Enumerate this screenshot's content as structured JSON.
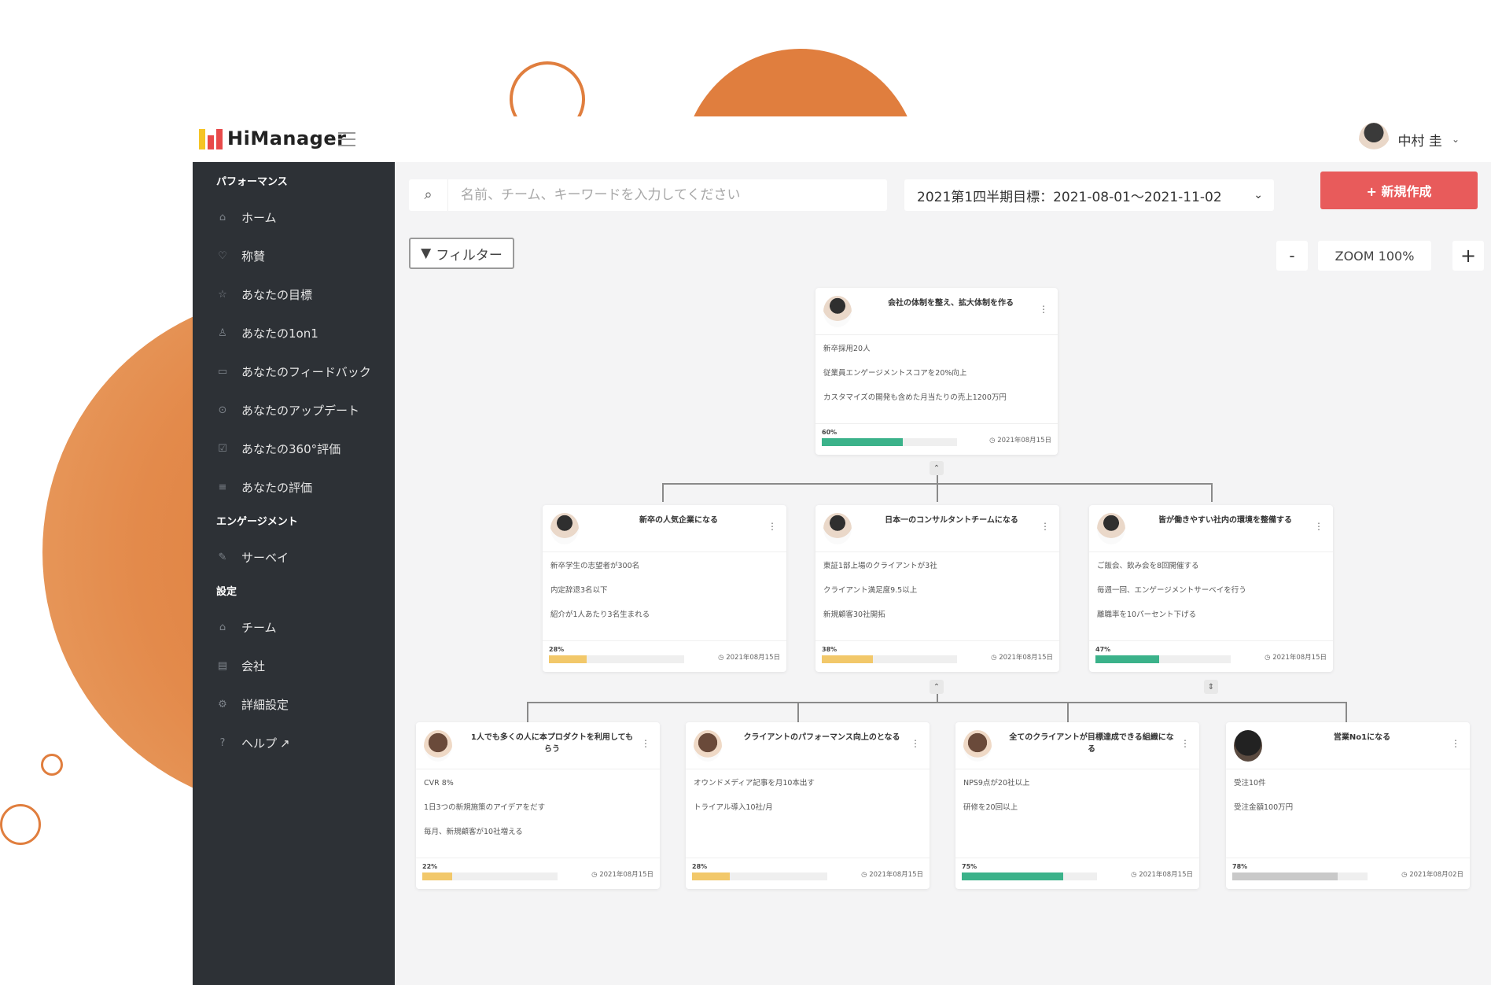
{
  "app": {
    "name": "HiManager"
  },
  "user": {
    "name": "中村 圭"
  },
  "sidebar": {
    "sections": [
      {
        "title": "パフォーマンス",
        "items": [
          {
            "label": "ホーム",
            "icon": "home-icon"
          },
          {
            "label": "称賛",
            "icon": "badge-icon"
          },
          {
            "label": "あなたの目標",
            "icon": "star-icon"
          },
          {
            "label": "あなたの1on1",
            "icon": "users-icon"
          },
          {
            "label": "あなたのフィードバック",
            "icon": "comment-icon"
          },
          {
            "label": "あなたのアップデート",
            "icon": "check-circle-icon"
          },
          {
            "label": "あなたの360°評価",
            "icon": "check-square-icon"
          },
          {
            "label": "あなたの評価",
            "icon": "list-icon"
          }
        ]
      },
      {
        "title": "エンゲージメント",
        "items": [
          {
            "label": "サーベイ",
            "icon": "edit-icon"
          }
        ]
      },
      {
        "title": "設定",
        "items": [
          {
            "label": "チーム",
            "icon": "team-icon"
          },
          {
            "label": "会社",
            "icon": "building-icon"
          },
          {
            "label": "詳細設定",
            "icon": "gears-icon"
          },
          {
            "label": "ヘルプ",
            "icon": "help-icon"
          }
        ]
      }
    ]
  },
  "search": {
    "placeholder": "名前、チーム、キーワードを入力してください"
  },
  "period": {
    "selected": "2021第1四半期目標：2021-08-01〜2021-11-02"
  },
  "actions": {
    "new_label": "+ 新規作成",
    "filter_label": "フィルター"
  },
  "zoom": {
    "minus": "-",
    "label": "ZOOM 100%",
    "plus": "+"
  },
  "colors": {
    "accent_red": "#e85b5b",
    "green": "#3bb28a",
    "yellow": "#f2c86a",
    "gray": "#c9c9c9",
    "sidebar": "#2d3136",
    "orange": "#e07e3e"
  },
  "goals": {
    "root": {
      "title": "会社の体制を整え、拡大体制を作る",
      "krs": [
        "新卒採用20人",
        "従業員エンゲージメントスコアを20%向上",
        "カスタマイズの開発も含めた月当たりの売上1200万円"
      ],
      "progress_label": "60%",
      "progress": 0.6,
      "bar_color": "#3bb28a",
      "due": "2021年08月15日"
    },
    "level2": [
      {
        "title": "新卒の人気企業になる",
        "krs": [
          "新卒学生の志望者が300名",
          "内定辞退3名以下",
          "紹介が1人あたり3名生まれる"
        ],
        "progress_label": "28%",
        "progress": 0.28,
        "bar_color": "#f2c86a",
        "due": "2021年08月15日",
        "avatar": "m"
      },
      {
        "title": "日本一のコンサルタントチームになる",
        "krs": [
          "東証1部上場のクライアントが3社",
          "クライアント満足度9.5以上",
          "新規顧客30社開拓"
        ],
        "progress_label": "38%",
        "progress": 0.38,
        "bar_color": "#f2c86a",
        "due": "2021年08月15日",
        "avatar": "m"
      },
      {
        "title": "皆が働きやすい社内の環境を整備する",
        "krs": [
          "ご飯会、飲み会を8回開催する",
          "毎週一回、エンゲージメントサーベイを行う",
          "離職率を10パーセント下げる"
        ],
        "progress_label": "47%",
        "progress": 0.47,
        "bar_color": "#3bb28a",
        "due": "2021年08月15日",
        "avatar": "m"
      }
    ],
    "level3": [
      {
        "title": "1人でも多くの人に本プロダクトを利用してもらう",
        "krs": [
          "CVR 8%",
          "1日3つの新規施策のアイデアをだす",
          "毎月、新規顧客が10社増える"
        ],
        "progress_label": "22%",
        "progress": 0.22,
        "bar_color": "#f2c86a",
        "due": "2021年08月15日",
        "avatar": "f"
      },
      {
        "title": "クライアントのパフォーマンス向上のとなる",
        "krs": [
          "オウンドメディア記事を月10本出す",
          "トライアル導入10社/月"
        ],
        "progress_label": "28%",
        "progress": 0.28,
        "bar_color": "#f2c86a",
        "due": "2021年08月15日",
        "avatar": "f"
      },
      {
        "title": "全てのクライアントが目標達成できる組織になる",
        "krs": [
          "NPS9点が20社以上",
          "研修を20回以上"
        ],
        "progress_label": "75%",
        "progress": 0.75,
        "bar_color": "#3bb28a",
        "due": "2021年08月15日",
        "avatar": "f"
      },
      {
        "title": "営業No1になる",
        "krs": [
          "受注10件",
          "受注金額100万円"
        ],
        "progress_label": "78%",
        "progress": 0.78,
        "bar_color": "#c9c9c9",
        "due": "2021年08月02日",
        "avatar": "dk"
      }
    ]
  }
}
